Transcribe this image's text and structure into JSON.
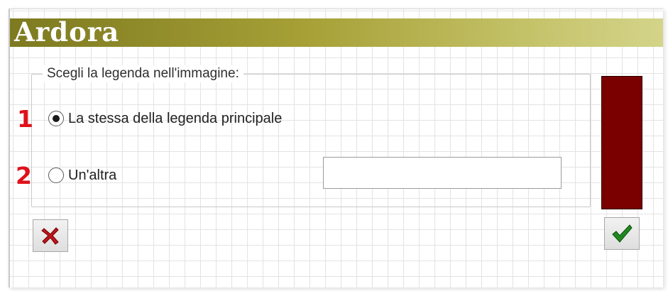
{
  "window": {
    "title": "Ardora"
  },
  "legend_group": {
    "heading": "Scegli la legenda nell'immagine:",
    "options": [
      {
        "marker": "1",
        "label": "La stessa della legenda principale",
        "selected": true
      },
      {
        "marker": "2",
        "label": "Un'altra",
        "selected": false
      }
    ],
    "other_input_value": ""
  },
  "colors": {
    "title_bar": "#a6a036",
    "swatch": "#7a0000",
    "step_number": "#e0101a",
    "cancel": "#c0141c",
    "ok": "#1f8a1f"
  },
  "buttons": {
    "cancel_icon": "red-x-icon",
    "ok_icon": "green-checkmark-icon"
  }
}
